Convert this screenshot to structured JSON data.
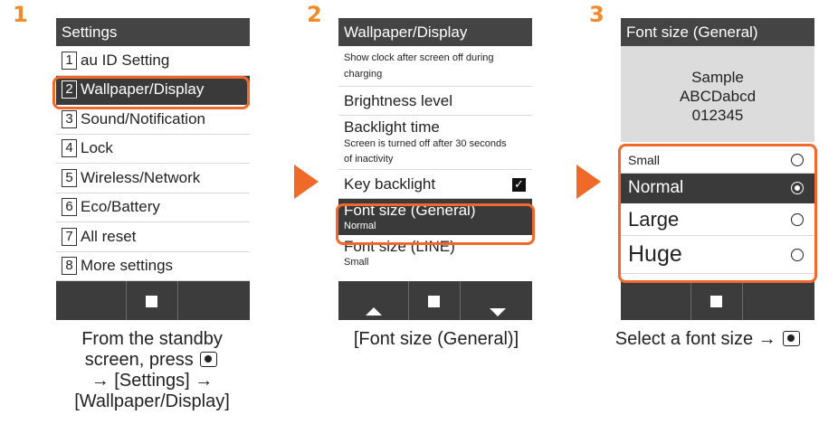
{
  "steps": [
    "1",
    "2",
    "3"
  ],
  "phone1": {
    "title": "Settings",
    "menu": [
      {
        "num": "1",
        "label": "au ID Setting"
      },
      {
        "num": "2",
        "label": "Wallpaper/Display",
        "selected": true
      },
      {
        "num": "3",
        "label": "Sound/Notification"
      },
      {
        "num": "4",
        "label": "Lock"
      },
      {
        "num": "5",
        "label": "Wireless/Network"
      },
      {
        "num": "6",
        "label": "Eco/Battery"
      },
      {
        "num": "7",
        "label": "All reset"
      },
      {
        "num": "8",
        "label": "More settings"
      }
    ]
  },
  "phone2": {
    "title": "Wallpaper/Display",
    "rows": [
      {
        "line1": "Show clock after screen off during",
        "line2": "charging"
      },
      {
        "title": "Brightness level"
      },
      {
        "title": "Backlight time",
        "desc1": "Screen is turned off after 30 seconds",
        "desc2": "of inactivity"
      },
      {
        "title": "Key backlight",
        "checked": true
      },
      {
        "title": "Font size (General)",
        "sub": "Normal",
        "selected": true
      },
      {
        "title": "Font size (LINE)",
        "sub": "Small"
      }
    ]
  },
  "phone3": {
    "title": "Font size (General)",
    "sample": [
      "Sample",
      "ABCDabcd",
      "012345"
    ],
    "options": [
      {
        "label": "Small"
      },
      {
        "label": "Normal",
        "selected": true
      },
      {
        "label": "Large"
      },
      {
        "label": "Huge"
      }
    ]
  },
  "captions": {
    "c1_line1": "From the standby",
    "c1_line2": "screen, press",
    "c1_line3": "→ [Settings] →",
    "c1_line4": "[Wallpaper/Display]",
    "c2": "[Font size (General)]",
    "c3": "Select a font size →"
  },
  "icons": {
    "center_key": "camera-key-icon",
    "checkbox": "checkmark-icon",
    "radio": "radio-button-icon",
    "softkey_center": "square-icon",
    "softkey_up": "triangle-up-icon",
    "softkey_down": "triangle-down-icon"
  },
  "colors": {
    "accent": "#f0682a",
    "step_number": "#f18a2c",
    "header_bg": "#444444",
    "selected_bg": "#3a3a3a",
    "softkey_bg": "#3c3c3c",
    "sample_bg": "#dcdcdc"
  }
}
